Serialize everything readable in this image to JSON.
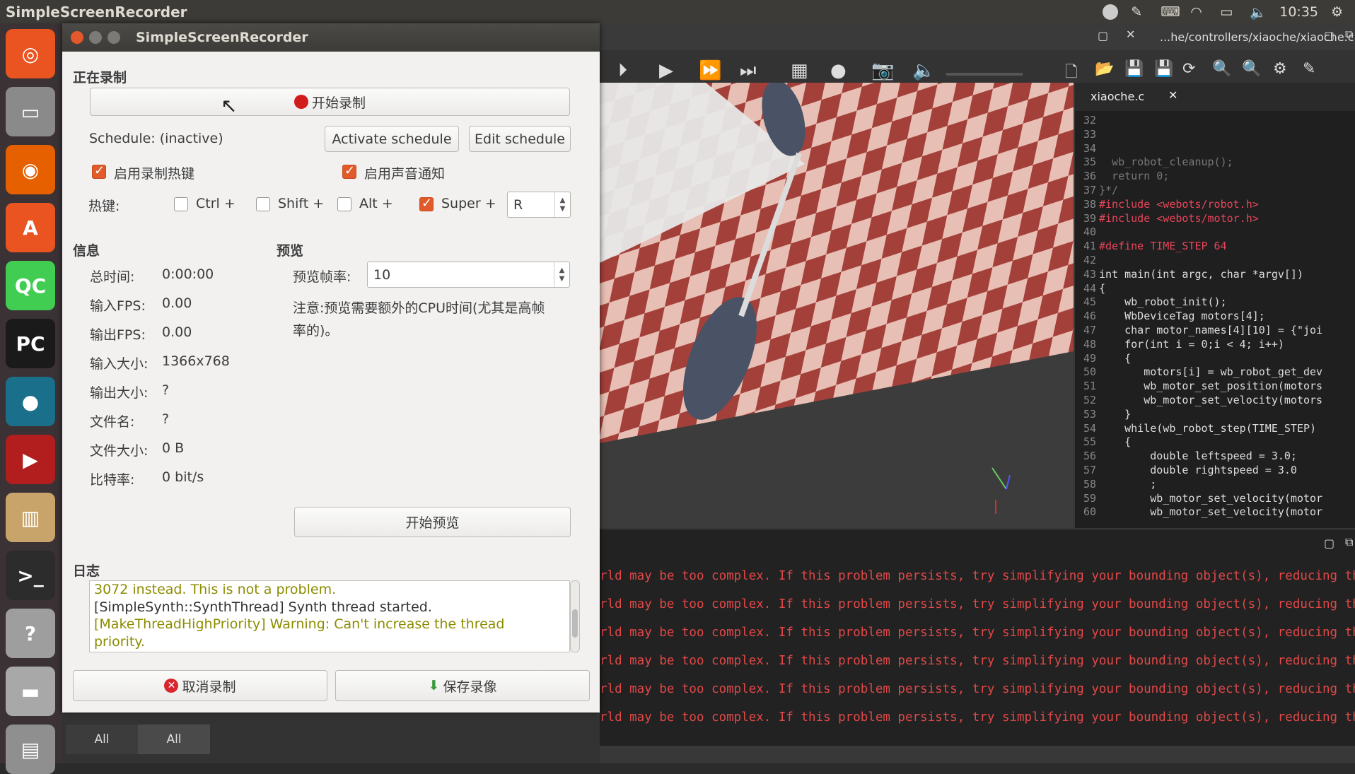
{
  "topbar": {
    "app_title": "SimpleScreenRecorder",
    "time": "10:35"
  },
  "launcher": {
    "items": [
      {
        "name": "ubuntu-dash-icon",
        "color": "#e95420",
        "glyph": "◎"
      },
      {
        "name": "files-icon",
        "color": "#8a8a8a",
        "glyph": "▭"
      },
      {
        "name": "firefox-icon",
        "color": "#e66000",
        "glyph": "◉"
      },
      {
        "name": "software-center-icon",
        "color": "#e95420",
        "glyph": "A"
      },
      {
        "name": "qtcreator-icon",
        "color": "#41cd52",
        "glyph": "QC"
      },
      {
        "name": "pycharm-icon",
        "color": "#1a1a1a",
        "glyph": "PC"
      },
      {
        "name": "webots-icon",
        "color": "#1a6f8a",
        "glyph": "●"
      },
      {
        "name": "simplescreenrecorder-icon",
        "color": "#b21d1d",
        "glyph": "▶"
      },
      {
        "name": "book-reader-icon",
        "color": "#c8a46a",
        "glyph": "▥"
      },
      {
        "name": "terminal-icon",
        "color": "#2c2c2c",
        "glyph": ">_"
      },
      {
        "name": "help-icon",
        "color": "#9e9e9e",
        "glyph": "?"
      },
      {
        "name": "drive-icon",
        "color": "#a8a8a8",
        "glyph": "▬"
      },
      {
        "name": "trash-icon",
        "color": "#8f8f8f",
        "glyph": "▤"
      }
    ]
  },
  "webots": {
    "path_label": "...he/controllers/xiaoche/xiaoche.c",
    "editor_tab": "xiaoche.c",
    "code_lines": [
      {
        "n": "32",
        "t": ""
      },
      {
        "n": "33",
        "t": ""
      },
      {
        "n": "34",
        "t": ""
      },
      {
        "n": "35",
        "t": "  wb_robot_cleanup();",
        "c": "#777"
      },
      {
        "n": "36",
        "t": "  return 0;",
        "c": "#777"
      },
      {
        "n": "37",
        "t": "}*/",
        "c": "#777"
      },
      {
        "n": "38",
        "t": "#include <webots/robot.h>",
        "c": "#e8455a"
      },
      {
        "n": "39",
        "t": "#include <webots/motor.h>",
        "c": "#e8455a"
      },
      {
        "n": "40",
        "t": ""
      },
      {
        "n": "41",
        "t": "#define TIME_STEP 64",
        "c": "#e8455a"
      },
      {
        "n": "42",
        "t": ""
      },
      {
        "n": "43",
        "t": "int main(int argc, char *argv[])",
        "c": "#ddd"
      },
      {
        "n": "44",
        "t": "{",
        "c": "#ddd"
      },
      {
        "n": "45",
        "t": "    wb_robot_init();",
        "c": "#ddd"
      },
      {
        "n": "46",
        "t": "    WbDeviceTag motors[4];",
        "c": "#ddd"
      },
      {
        "n": "47",
        "t": "    char motor_names[4][10] = {\"joi",
        "c": "#ddd"
      },
      {
        "n": "48",
        "t": "    for(int i = 0;i < 4; i++)",
        "c": "#ddd"
      },
      {
        "n": "49",
        "t": "    {",
        "c": "#ddd"
      },
      {
        "n": "50",
        "t": "       motors[i] = wb_robot_get_dev",
        "c": "#ddd"
      },
      {
        "n": "51",
        "t": "       wb_motor_set_position(motors",
        "c": "#ddd"
      },
      {
        "n": "52",
        "t": "       wb_motor_set_velocity(motors",
        "c": "#ddd"
      },
      {
        "n": "53",
        "t": "    }",
        "c": "#ddd"
      },
      {
        "n": "54",
        "t": "    while(wb_robot_step(TIME_STEP)",
        "c": "#ddd"
      },
      {
        "n": "55",
        "t": "    {",
        "c": "#ddd"
      },
      {
        "n": "56",
        "t": "        double leftspeed = 3.0;",
        "c": "#ddd"
      },
      {
        "n": "57",
        "t": "        double rightspeed = 3.0",
        "c": "#ddd"
      },
      {
        "n": "58",
        "t": "        ;",
        "c": "#ddd"
      },
      {
        "n": "59",
        "t": "        wb_motor_set_velocity(motor",
        "c": "#ddd"
      },
      {
        "n": "60",
        "t": "        wb_motor_set_velocity(motor",
        "c": "#ddd"
      }
    ],
    "console_lines": [
      "rld may be too complex. If this problem persists, try simplifying your bounding object(s), reducing the",
      "rld may be too complex. If this problem persists, try simplifying your bounding object(s), reducing the",
      "rld may be too complex. If this problem persists, try simplifying your bounding object(s), reducing the",
      "rld may be too complex. If this problem persists, try simplifying your bounding object(s), reducing the",
      "rld may be too complex. If this problem persists, try simplifying your bounding object(s), reducing the",
      "rld may be too complex. If this problem persists, try simplifying your bounding object(s), reducing the"
    ],
    "bottom_tabs": [
      "All",
      "All"
    ]
  },
  "ssr": {
    "title": "SimpleScreenRecorder",
    "recording_section": "正在录制",
    "start_record": "开始录制",
    "schedule_status": "Schedule: (inactive)",
    "activate_schedule": "Activate schedule",
    "edit_schedule": "Edit schedule",
    "enable_hotkey": "启用录制热键",
    "enable_sound": "启用声音通知",
    "hotkey_label": "热键:",
    "ctrl": "Ctrl +",
    "shift": "Shift +",
    "alt": "Alt +",
    "super": "Super +",
    "hotkey_key": "R",
    "info_section": "信息",
    "info": [
      {
        "label": "总时间:",
        "value": "0:00:00"
      },
      {
        "label": "输入FPS:",
        "value": "0.00"
      },
      {
        "label": "输出FPS:",
        "value": "0.00"
      },
      {
        "label": "输入大小:",
        "value": "1366x768"
      },
      {
        "label": "输出大小:",
        "value": "?"
      },
      {
        "label": "文件名:",
        "value": "?"
      },
      {
        "label": "文件大小:",
        "value": "0 B"
      },
      {
        "label": "比特率:",
        "value": "0 bit/s"
      }
    ],
    "preview_section": "预览",
    "preview_fps_label": "预览帧率:",
    "preview_fps_value": "10",
    "preview_note_line1": "注意:预览需要额外的CPU时间(尤其是高帧",
    "preview_note_line2": "率的)。",
    "start_preview": "开始预览",
    "log_section": "日志",
    "log_lines": [
      {
        "t": "3072 instead. This is not a problem.",
        "k": "warn"
      },
      {
        "t": "[SimpleSynth::SynthThread] Synth thread started.",
        "k": "norm"
      },
      {
        "t": "[MakeThreadHighPriority] Warning: Can't increase the thread",
        "k": "warn"
      },
      {
        "t": "priority.",
        "k": "warn"
      }
    ],
    "cancel_record": "取消录制",
    "save_record": "保存录像"
  }
}
